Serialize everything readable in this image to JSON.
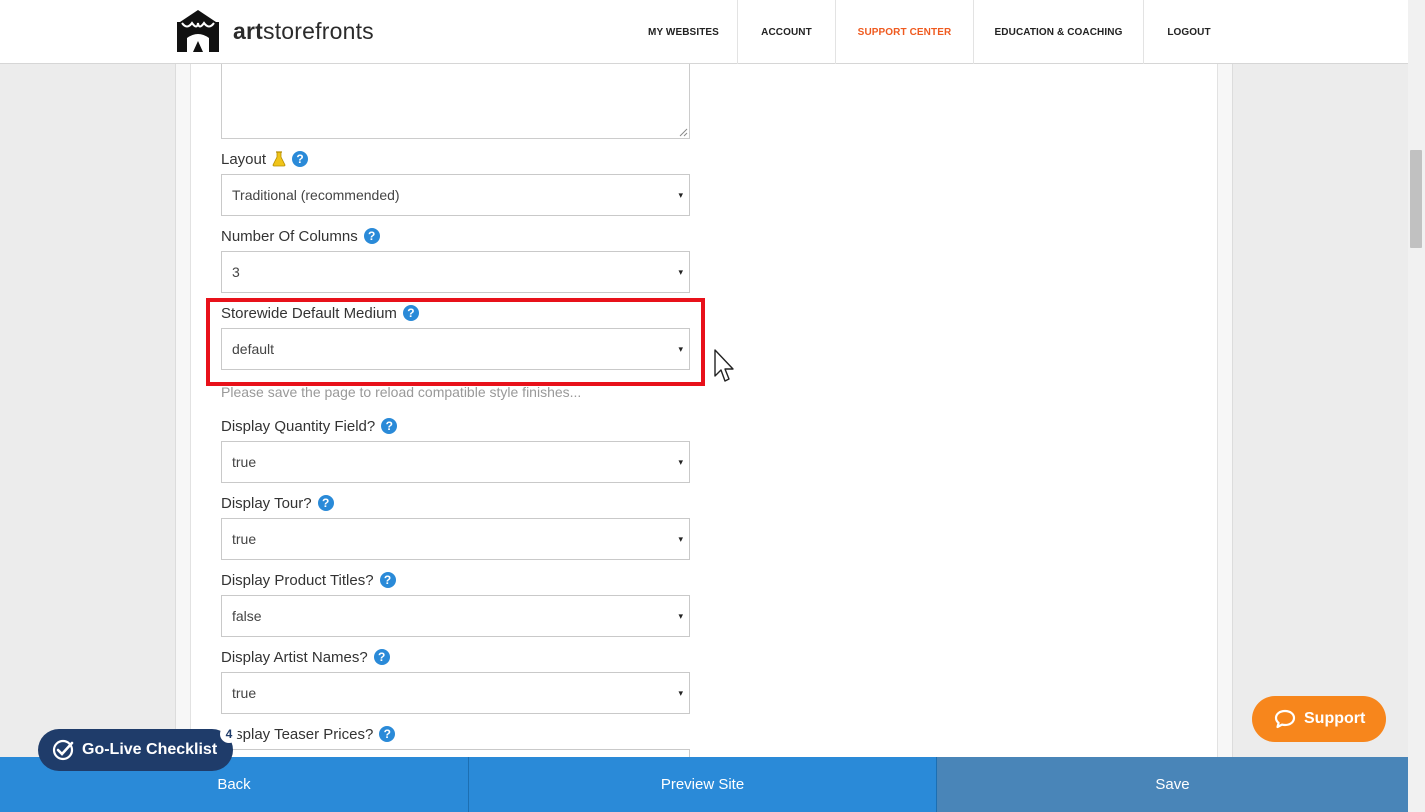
{
  "header": {
    "logo_bold": "art",
    "logo_rest": "storefronts",
    "nav": [
      {
        "label": "MY WEBSITES"
      },
      {
        "label": "ACCOUNT"
      },
      {
        "label": "SUPPORT CENTER",
        "active": true
      },
      {
        "label": "EDUCATION & COACHING"
      },
      {
        "label": "LOGOUT"
      }
    ]
  },
  "form": {
    "layout": {
      "label": "Layout",
      "value": "Traditional (recommended)"
    },
    "columns": {
      "label": "Number Of Columns",
      "value": "3"
    },
    "medium": {
      "label": "Storewide Default Medium",
      "value": "default",
      "hint": "Please save the page to reload compatible style finishes..."
    },
    "quantity": {
      "label": "Display Quantity Field?",
      "value": "true"
    },
    "tour": {
      "label": "Display Tour?",
      "value": "true"
    },
    "titles": {
      "label": "Display Product Titles?",
      "value": "false"
    },
    "artists": {
      "label": "Display Artist Names?",
      "value": "true"
    },
    "teaser": {
      "label": "Display Teaser Prices?"
    }
  },
  "help_glyph": "?",
  "caret_glyph": "▾",
  "golive": {
    "label": "Go-Live Checklist",
    "count": "4"
  },
  "support": {
    "label": "Support"
  },
  "bottom": {
    "back": "Back",
    "preview": "Preview Site",
    "save": "Save"
  },
  "colors": {
    "accent_blue": "#2a8ad8",
    "active_nav": "#ef5a1f",
    "highlight": "#e8111a",
    "support": "#f7861c",
    "golive": "#1f3c6a"
  }
}
